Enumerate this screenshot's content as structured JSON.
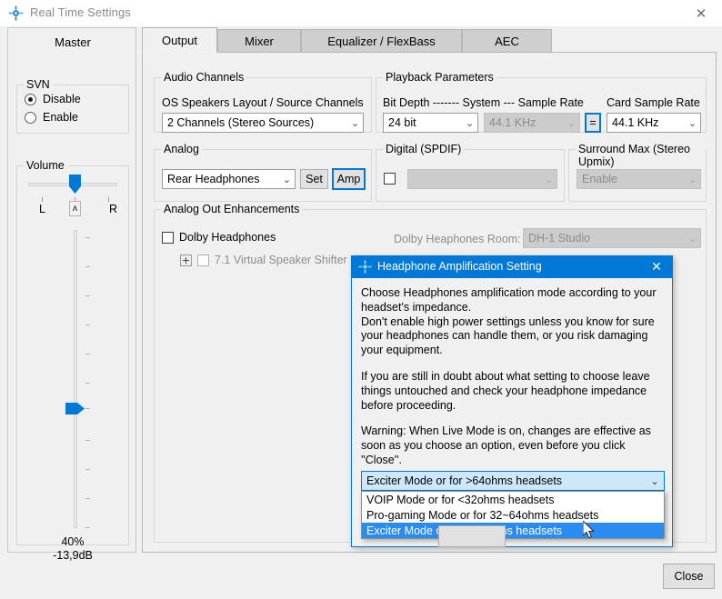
{
  "window": {
    "title": "Real Time Settings",
    "icon": "app-icon",
    "close_label": "✕"
  },
  "master": {
    "title": "Master",
    "svn": {
      "legend": "SVN",
      "options": [
        {
          "label": "Disable",
          "checked": true
        },
        {
          "label": "Enable",
          "checked": false
        }
      ]
    },
    "volume": {
      "legend": "Volume",
      "balance_left_label": "L",
      "balance_right_label": "R",
      "balance_center_glyph": "ʌ",
      "percent": "40%",
      "db": "-13,9dB"
    }
  },
  "tabs": [
    {
      "label": "Output",
      "active": true
    },
    {
      "label": "Mixer",
      "active": false
    },
    {
      "label": "Equalizer / FlexBass",
      "active": false
    },
    {
      "label": "AEC",
      "active": false
    }
  ],
  "output_tab": {
    "audio_channels": {
      "legend": "Audio Channels",
      "os_layout_label": "OS Speakers Layout / Source Channels",
      "os_layout_value": "2 Channels (Stereo Sources)"
    },
    "playback_parameters": {
      "legend": "Playback Parameters",
      "bit_depth_label": "Bit Depth ------- System --- Sample Rate",
      "bit_depth_value": "24 bit",
      "system_rate_value": "44.1 KHz",
      "equals_button": "=",
      "card_rate_label": "Card Sample Rate",
      "card_rate_value": "44.1 KHz"
    },
    "analog": {
      "legend": "Analog",
      "device_value": "Rear Headphones",
      "set_button": "Set",
      "amp_button": "Amp"
    },
    "digital": {
      "legend": "Digital (SPDIF)",
      "checkbox_checked": false,
      "combo_value": ""
    },
    "surround": {
      "legend": "Surround Max (Stereo Upmix)",
      "combo_value": "Enable"
    },
    "enhancements": {
      "legend": "Analog Out Enhancements",
      "dolby_headphones_label": "Dolby Headphones",
      "dolby_headphones_checked": false,
      "expander_glyph": "+",
      "virtual_shifter_label": "7.1 Virtual Speaker Shifter",
      "virtual_shifter_checked": false,
      "room_label": "Dolby Heaphones Room:",
      "room_value": "DH-1 Studio"
    }
  },
  "footer": {
    "close_button": "Close"
  },
  "dialog": {
    "title": "Headphone Amplification Setting",
    "icon": "app-icon",
    "close_label": "✕",
    "paragraphs": [
      "Choose Headphones amplification mode according to your headset's impedance.\nDon't enable high power settings unless you know for sure your headphones can handle them, or you risk damaging your equipment.",
      "If you are still in doubt about what setting to choose leave things untouched and check your headphone impedance before proceeding.",
      "Warning: When Live Mode is on, changes are effective as soon as you choose an option, even before you click ''Close''."
    ],
    "combo_value": "Exciter Mode or for >64ohms headsets",
    "options": [
      {
        "label": "VOIP Mode or for <32ohms headsets",
        "selected": false
      },
      {
        "label": "Pro-gaming Mode or for 32~64ohms headsets",
        "selected": false
      },
      {
        "label": "Exciter Mode or for >64ohms headsets",
        "selected": true
      }
    ]
  },
  "colors": {
    "accent": "#0078d7",
    "selection": "#2a8cf0",
    "window_bg": "#f0f0f0",
    "tab_inactive": "#cfcfcf"
  }
}
